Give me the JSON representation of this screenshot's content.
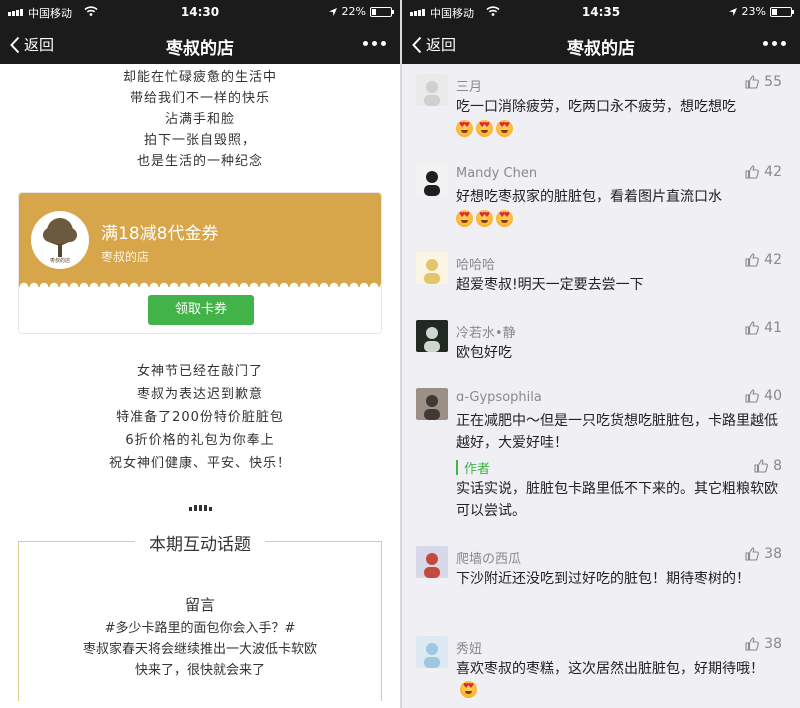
{
  "status_left": {
    "carrier": "中国移动",
    "time": "14:30",
    "battery": "22%",
    "battery_level": 0.22
  },
  "status_right": {
    "carrier": "中国移动",
    "time": "14:35",
    "battery": "23%",
    "battery_level": 0.23
  },
  "nav": {
    "back_label": "返回",
    "title": "枣叔的店"
  },
  "article": {
    "poem_top": [
      "却能在忙碌疲惫的生活中",
      "带给我们不一样的快乐",
      "沾满手和脸",
      "拍下一张自毁照，",
      "也是生活的一种纪念"
    ],
    "coupon": {
      "title": "满18减8代金券",
      "shop": "枣叔的店",
      "button": "领取卡券",
      "logo_text": "枣叔的店"
    },
    "poem_middle": [
      "女神节已经在敲门了",
      "枣叔为表达迟到歉意",
      "特准备了200份特价脏脏包",
      "6折价格的礼包为你奉上",
      "祝女神们健康、平安、快乐！"
    ],
    "topic": {
      "title": "本期互动话题",
      "subtitle": "留言",
      "lines": [
        "#多少卡路里的面包你会入手？#",
        "枣叔家春天将会继续推出一大波低卡软欧",
        "快来了，很快就会来了"
      ]
    }
  },
  "comments": [
    {
      "name": "三月",
      "likes": "55",
      "text": "吃一口消除疲劳，吃两口永不疲劳，想吃想吃",
      "emoji_count": 3
    },
    {
      "name": "Mandy Chen",
      "likes": "42",
      "text": "好想吃枣叔家的脏脏包，看着图片直流口水",
      "emoji_count": 3
    },
    {
      "name": "哈哈哈",
      "likes": "42",
      "text": "超爱枣叔!明天一定要去尝一下",
      "emoji_count": 0
    },
    {
      "name": "冷若水•静",
      "likes": "41",
      "text": "欧包好吃",
      "emoji_count": 0
    },
    {
      "name": "ɑ-Gypsophila",
      "likes": "40",
      "text": "正在减肥中～但是一只吃货想吃脏脏包，卡路里越低越好，大爱好哇！",
      "emoji_count": 0,
      "reply": {
        "label": "作者",
        "likes": "8",
        "text": "实话实说，脏脏包卡路里低不下来的。其它粗粮软欧可以尝试。"
      }
    },
    {
      "name": "爬墙の西瓜",
      "likes": "38",
      "text": "下沙附近还没吃到过好吃的脏包！期待枣树的！",
      "emoji_count": 0
    },
    {
      "name": "秀妞",
      "likes": "38",
      "text": "喜欢枣叔的枣糕，这次居然出脏脏包，好期待哦！",
      "emoji_count": 1
    }
  ],
  "colors": {
    "nav_bg": "#1b1b1b",
    "coupon_gold": "#d8a64a",
    "wechat_green": "#42b348",
    "feed_bg": "#efeff4"
  },
  "icons": {
    "back": "chevron-left-icon",
    "more": "more-dots-icon",
    "like": "thumbs-up-icon",
    "location": "location-arrow-icon",
    "wifi": "wifi-icon"
  }
}
